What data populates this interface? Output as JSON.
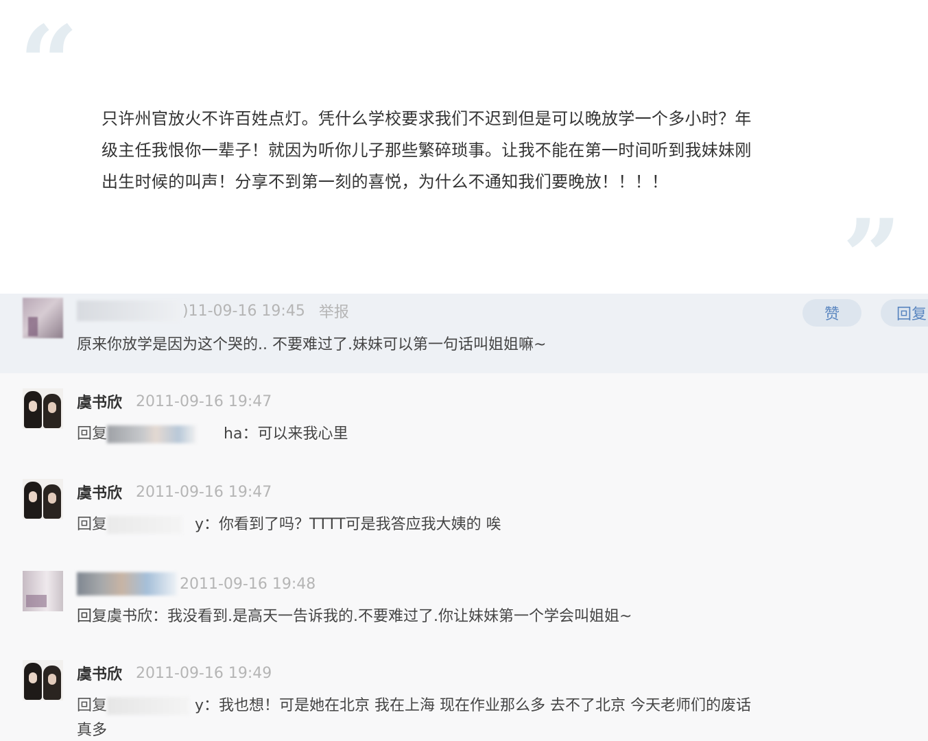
{
  "quote": {
    "open_mark": "“",
    "close_mark": "”",
    "lines": [
      "只许州官放火不许百姓点灯。凭什么学校要求我们不迟到但是可以晚放学一个多小时？年",
      "级主任我恨你一辈子！就因为听你儿子那些繁碎琐事。让我不能在第一时间听到我妹妹刚",
      "出生时候的叫声！分享不到第一刻的喜悦，为什么不通知我们要晚放！！！！"
    ]
  },
  "comments": [
    {
      "username": "",
      "timestamp": ")11-09-16 19:45",
      "report": "举报",
      "text": "原来你放学是因为这个哭的.. 不要难过了.妹妹可以第一句话叫姐姐嘛~",
      "like_label": "赞",
      "reply_label": "回复"
    },
    {
      "username": "虞书欣",
      "timestamp": "2011-09-16 19:47",
      "reply_prefix": "回复",
      "reply_tail": "ha：可以来我心里"
    },
    {
      "username": "虞书欣",
      "timestamp": "2011-09-16 19:47",
      "reply_prefix": "回复",
      "reply_tail": "y：你看到了吗？TTTT可是我答应我大姨的  唉"
    },
    {
      "username": "",
      "timestamp": "2011-09-16 19:48",
      "text": "回复虞书欣：我没看到.是高天一告诉我的.不要难过了.你让妹妹第一个学会叫姐姐~"
    },
    {
      "username": "虞书欣",
      "timestamp": "2011-09-16 19:49",
      "reply_prefix": "回复",
      "reply_tail": "y：我也想！可是她在北京 我在上海 现在作业那么多  去不了北京 今天老师们的废话",
      "continuation": "真多"
    }
  ]
}
